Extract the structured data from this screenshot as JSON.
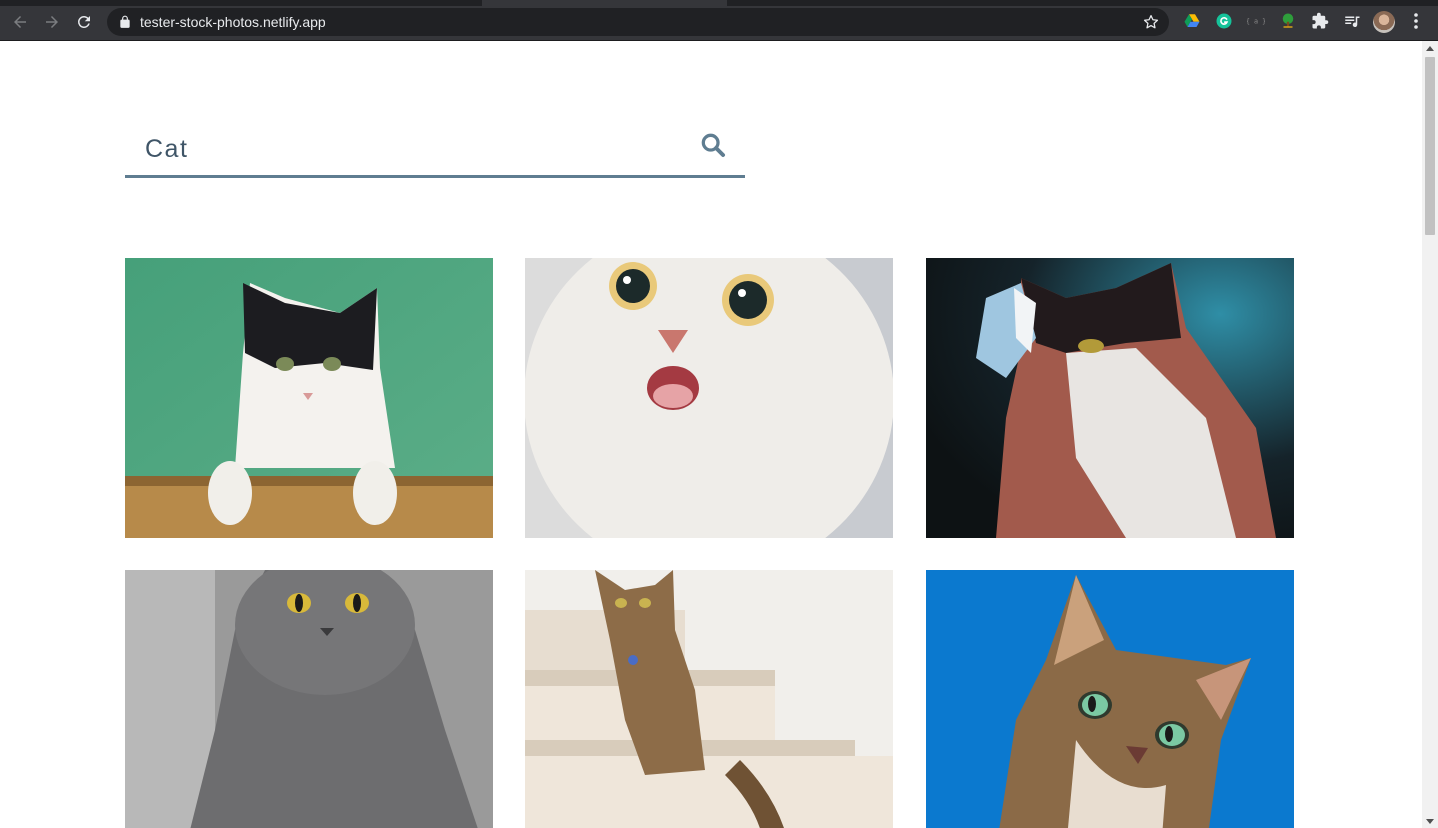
{
  "browser": {
    "url": "tester-stock-photos.netlify.app",
    "colors": {
      "chrome_bg": "#35363a",
      "omnibox_bg": "#202124",
      "url_text": "#e8eaed"
    },
    "extensions": [
      "google-drive-icon",
      "grammarly-icon",
      "json-viewer-icon",
      "tree-extension-icon",
      "extensions-puzzle-icon",
      "reading-list-icon"
    ]
  },
  "search": {
    "value": "Cat",
    "placeholder": "",
    "accent_color": "#5f7d91"
  },
  "results": [
    {
      "name": "cat-black-white-green-bg",
      "bg": "#4fa37e"
    },
    {
      "name": "cat-white-surprised",
      "bg": "#e4e3e1"
    },
    {
      "name": "cat-butterfly",
      "bg": "#1e2a2c"
    },
    {
      "name": "cat-grey-british-shorthair",
      "bg": "#6c6c6c"
    },
    {
      "name": "cat-tabby-stairs",
      "bg": "#f2f0ec"
    },
    {
      "name": "cat-tabby-blue-sky",
      "bg": "#0b79cf"
    }
  ]
}
